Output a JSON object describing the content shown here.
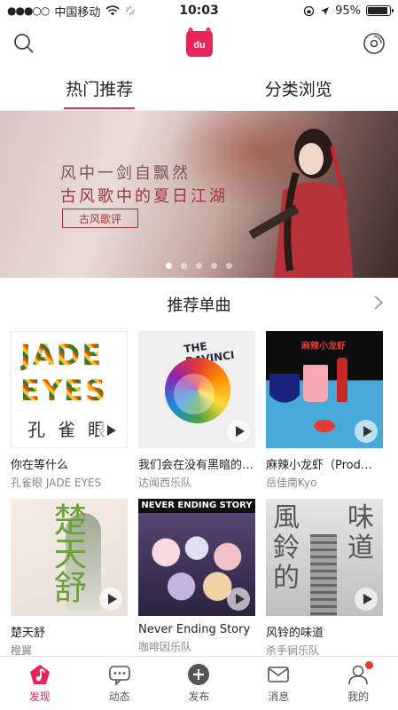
{
  "status_bar": {
    "carrier": "中国移动",
    "time": "10:03",
    "battery": "95%"
  },
  "tabs": [
    {
      "label": "热门推荐",
      "active": true
    },
    {
      "label": "分类浏览",
      "active": false
    }
  ],
  "banner": {
    "line1": "风中一剑自飘然",
    "line2": "古风歌中的夏日江湖",
    "tag": "古风歌评",
    "page_count": 5,
    "active_page": 1
  },
  "section": {
    "title": "推荐单曲"
  },
  "songs": [
    {
      "title": "你在等什么",
      "artist": "孔雀眼 JADE EYES",
      "cover_text": "JADE EYES",
      "cover_sub": "孔雀眼"
    },
    {
      "title": "我们会在没有黑暗的地方相见",
      "artist": "达闻西乐队",
      "cover_text": "THE DAVINCI"
    },
    {
      "title": "麻辣小龙虾（Prod…",
      "artist": "岳佳南Kyo",
      "cover_text": "麻辣小龙虾"
    },
    {
      "title": "楚天舒",
      "artist": "橙翼",
      "cover_text": "楚天舒"
    },
    {
      "title": "Never Ending Story",
      "artist": "咖啡因乐队",
      "cover_text": "NEVER ENDING STORY"
    },
    {
      "title": "风铃的味道",
      "artist": "杀手锏乐队",
      "cover_text": "風鈴的味道"
    }
  ],
  "bottom_nav": [
    {
      "label": "发现",
      "icon": "music-note-icon",
      "active": true
    },
    {
      "label": "动态",
      "icon": "chat-bubble-icon",
      "active": false
    },
    {
      "label": "发布",
      "icon": "plus-circle-icon",
      "active": false
    },
    {
      "label": "消息",
      "icon": "mail-icon",
      "active": false
    },
    {
      "label": "我的",
      "icon": "user-icon",
      "active": false,
      "badge": true
    }
  ],
  "colors": {
    "accent": "#e8245b"
  }
}
